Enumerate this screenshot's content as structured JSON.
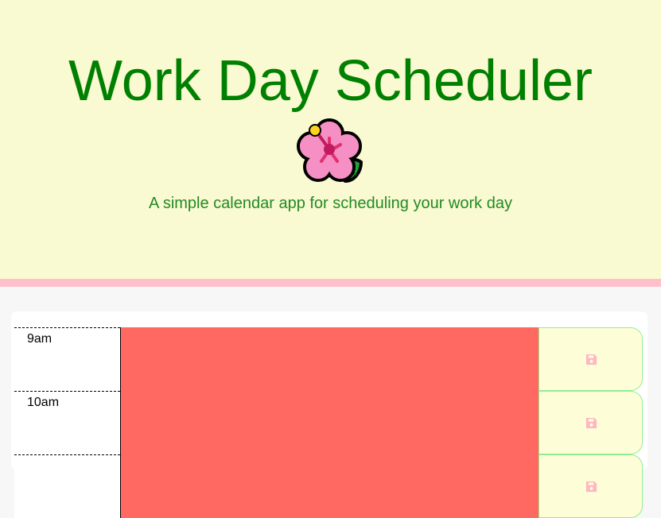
{
  "header": {
    "title": "Work Day Scheduler",
    "logo_icon": "hibiscus-icon",
    "lead": "A simple calendar app for scheduling your work day"
  },
  "colors": {
    "header_bg": "#f9f9d2",
    "title": "#008000",
    "lead": "#228b22",
    "header_border": "#ffc0cb",
    "past_block": "#ff6961",
    "save_button_bg": "#fdfed8",
    "save_button_border": "#90ee90",
    "save_icon": "#ffb6c1"
  },
  "time_blocks": [
    {
      "hour": "9am",
      "description": "",
      "save_icon": "save-icon"
    },
    {
      "hour": "10am",
      "description": "",
      "save_icon": "save-icon"
    },
    {
      "hour": "",
      "description": "",
      "save_icon": "save-icon"
    }
  ]
}
